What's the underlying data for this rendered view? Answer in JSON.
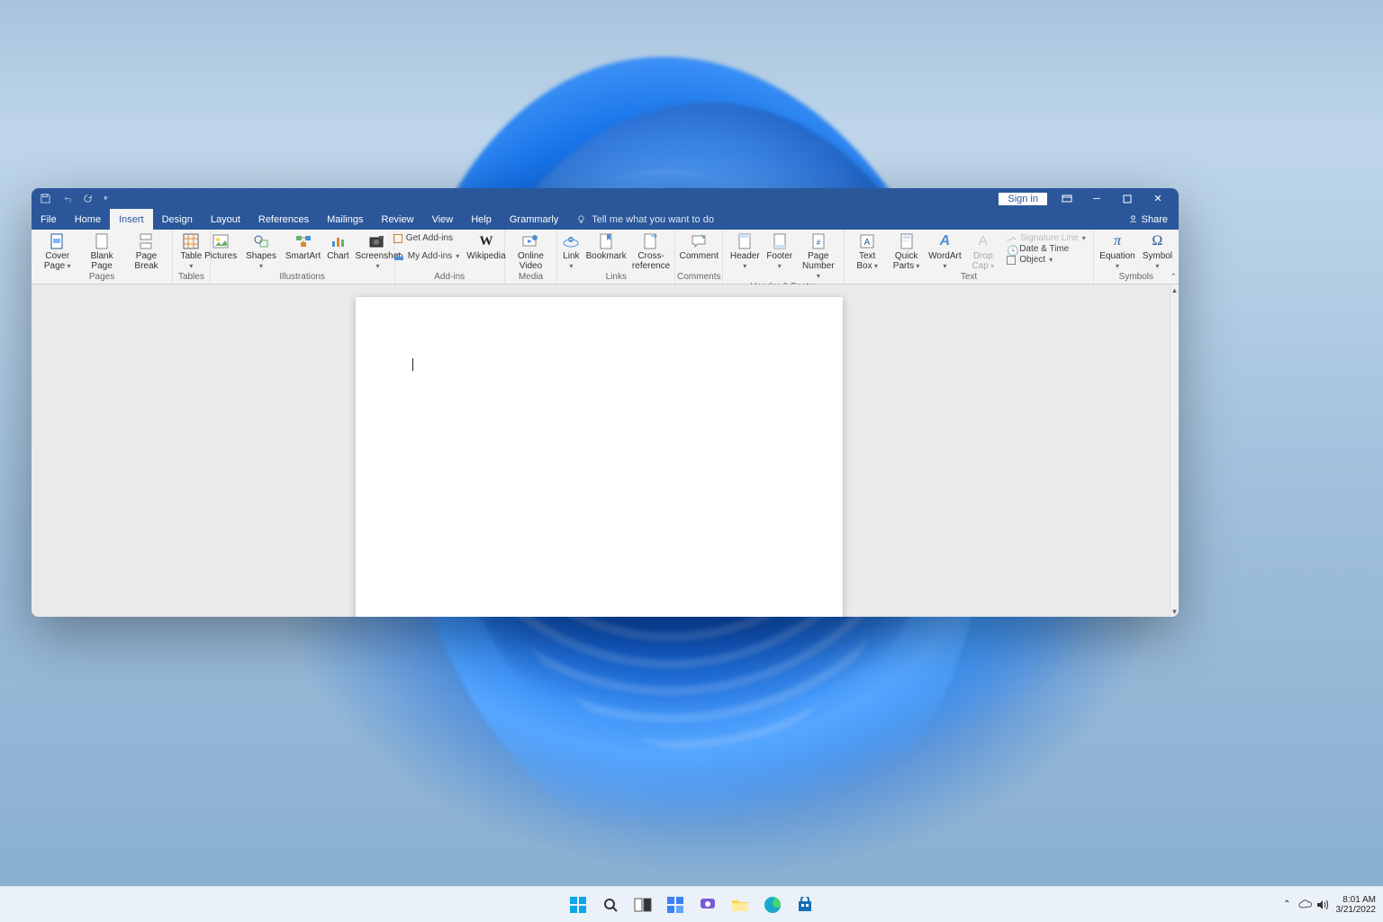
{
  "titlebar": {
    "signin": "Sign in"
  },
  "tabs": {
    "file": "File",
    "home": "Home",
    "insert": "Insert",
    "design": "Design",
    "layout": "Layout",
    "references": "References",
    "mailings": "Mailings",
    "review": "Review",
    "view": "View",
    "help": "Help",
    "grammarly": "Grammarly",
    "tellme": "Tell me what you want to do",
    "share": "Share"
  },
  "ribbon": {
    "pages": {
      "label": "Pages",
      "cover_page": "Cover Page",
      "blank_page": "Blank Page",
      "page_break": "Page Break"
    },
    "tables": {
      "label": "Tables",
      "table": "Table"
    },
    "illustrations": {
      "label": "Illustrations",
      "pictures": "Pictures",
      "shapes": "Shapes",
      "smartart": "SmartArt",
      "chart": "Chart",
      "screenshot": "Screenshot"
    },
    "addins": {
      "label": "Add-ins",
      "get": "Get Add-ins",
      "my": "My Add-ins",
      "wikipedia": "Wikipedia"
    },
    "media": {
      "label": "Media",
      "online_video": "Online Video"
    },
    "links": {
      "label": "Links",
      "link": "Link",
      "bookmark": "Bookmark",
      "crossref": "Cross-reference"
    },
    "comments": {
      "label": "Comments",
      "comment": "Comment"
    },
    "header_footer": {
      "label": "Header & Footer",
      "header": "Header",
      "footer": "Footer",
      "page_number": "Page Number"
    },
    "text": {
      "label": "Text",
      "text_box": "Text Box",
      "quick_parts": "Quick Parts",
      "wordart": "WordArt",
      "drop_cap": "Drop Cap",
      "signature_line": "Signature Line",
      "date_time": "Date & Time",
      "object": "Object"
    },
    "symbols": {
      "label": "Symbols",
      "equation": "Equation",
      "symbol": "Symbol"
    }
  },
  "taskbar": {
    "time": "8:01 AM",
    "date": "3/21/2022"
  }
}
